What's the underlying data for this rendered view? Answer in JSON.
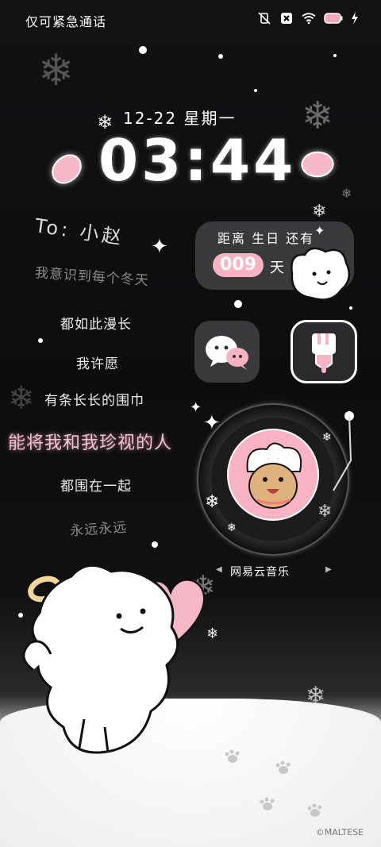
{
  "status_bar": {
    "carrier_text": "仅可紧急通话",
    "icons": [
      "vibrate-off-icon",
      "sim-missing-icon",
      "wifi-icon",
      "battery-icon",
      "charging-icon"
    ]
  },
  "lock_clock": {
    "date": "12-22 星期一",
    "time": "03:44"
  },
  "poem": {
    "to": "To: 小赵",
    "lines": [
      "我意识到每个冬天",
      "都如此漫长",
      "我许愿",
      "有条长长的围巾",
      "能将我和我珍视的人",
      "都围在一起",
      "永远永远"
    ]
  },
  "countdown_widget": {
    "label": "距离 生日 还有",
    "days": "009",
    "unit": "天"
  },
  "apps": {
    "wechat_icon": "wechat-icon",
    "popsicle_icon": "popsicle-icon"
  },
  "music_widget": {
    "app_name": "网易云音乐",
    "prev_arrow": "◀",
    "next_arrow": "▶"
  },
  "watermark": "©MALTESE",
  "colors": {
    "accent_pink": "#f7b2c4",
    "tile_gray": "#3a3a3c",
    "background": "#0c0c0d"
  }
}
